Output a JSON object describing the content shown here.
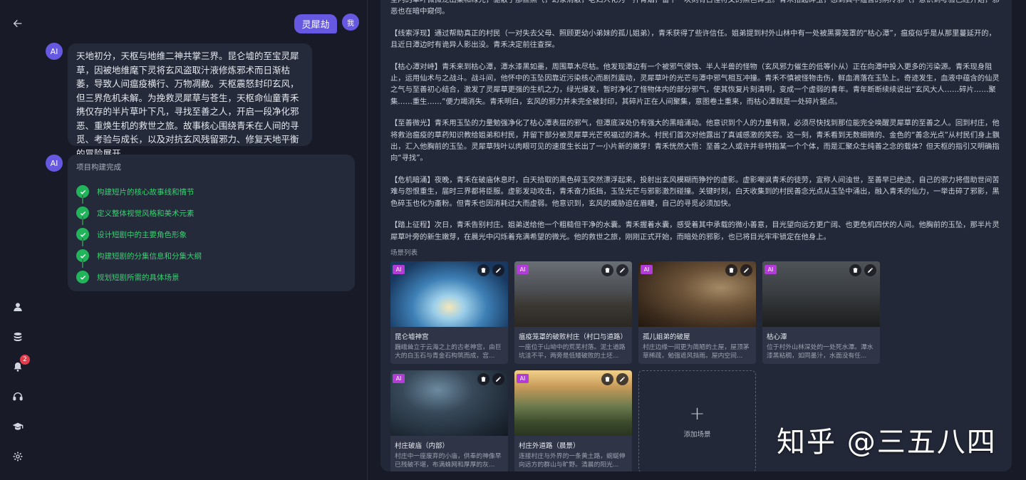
{
  "sidebar": {
    "notification_count": "2"
  },
  "chat": {
    "user_message": "灵犀劫",
    "user_avatar_label": "我",
    "ai_avatar_label": "AI",
    "ai_message": "天地初分，天枢与地维二神共掌三界。昆仑墟的至宝灵犀草，因被地维麾下灵将玄风盗取汁液修炼邪术而日渐枯萎，导致人间瘟疫横行、万物凋敝。天枢震怒封印玄风，但三界危机未解。为挽救灵犀草与苍生，天枢命仙童青禾携仅存的半片草叶下凡，寻找至善之人，开启一段净化邪恶、重焕生机的救世之旅。故事核心围绕青禾在人间的寻觅、考验与成长，以及对抗玄风残留邪力、修复天地平衡的冒险展开。",
    "steps_title": "项目构建完成",
    "steps": [
      "构建短片的核心故事线和情节",
      "定义整体视觉风格和美术元素",
      "设计短剧中的主要角色形象",
      "构建短剧的分集信息和分集大纲",
      "规划短剧所需的具体场景"
    ]
  },
  "story": {
    "paragraphs": [
      "坚内的草叶微微泛出柔和绿光，驱散了那丝黑气，幻象消散，老妇人化为一抔青烟，留下一块刻有古怪符文的黑色碎玉。青禾拾起碎玉，感到其中蕴含的阴冷邪气，意识到考验已经开始，邪恶也在暗中窥伺。",
      "【线索浮现】通过帮助真正的村民（一对失去父母、照顾更幼小弟妹的孤儿姐弟），青禾获得了些许信任。姐弟提到村外山林中有一处被黑雾笼罩的“枯心潭”，瘟疫似乎是从那里蔓延开的，且近日潭边时有诡异人影出没。青禾决定前往查探。",
      "【枯心潭对峙】青禾来到枯心潭，潭水漆黑如墨，周围草木尽枯。他发现潭边有一个被邪气侵蚀、半人半兽的怪物（玄风邪力催生的低等仆从）正在向潭中投入更多的污染源。青禾现身阻止，运用仙术与之战斗。战斗间，他怀中的玉坠因靠近污染核心而剧烈震动，灵犀草叶的光芒与潭中邪气相互冲撞。青禾不慎被怪物击伤，鲜血滴落在玉坠上。奇迹发生，血液中蕴含的仙灵之气与至善初心结合，激发了灵犀草更强的生机之力，绿光爆发，暂时净化了怪物体内的部分邪气，使其恢复片刻清明，变成一个虚弱的青年。青年断断续续说出“玄风大人……碎片……聚集……重生……”便力竭消失。青禾明白，玄风的邪力并未完全被封印，其碎片正在人间聚集，意图卷土重来，而枯心潭就是一处碎片据点。",
      "【至善微光】青禾用玉坠的力量勉强净化了枯心潭表层的邪气，但潭底深处仍有强大的黑暗涌动。他意识到个人的力量有限，必须尽快找到那位能完全唤醒灵犀草的至善之人。回到村庄，他将救治瘟疫的草药知识教给姐弟和村民，并留下部分被灵犀草光芒祝福过的清水。村民们首次对他露出了真诚感激的笑容。这一刻，青禾看到无数细微的、金色的“善念光点”从村民们身上飘出，汇入他胸前的玉坠。灵犀草残叶以肉眼可见的速度生长出了一小片新的嫩芽！青禾恍然大悟：至善之人或许并非特指某一个个体，而是汇聚众生纯善之念的载体？但天枢的指引又明确指向“寻找”。",
      "【危机暗涌】夜晚，青禾在破庙休息时，白天拾取的黑色碎玉突然漂浮起来，投射出玄风模糊而狰狞的虚影。虚影嘲讽青禾的徒劳，宣称人间浊世，至善早已绝迹，自己的邪力将借助世间苦难与怨恨重生，届时三界都将臣服。虚影发动攻击，青禾奋力抵挡，玉坠光芒与邪影激烈碰撞。关键时刻，白天收集到的村民善念光点从玉坠中涌出，融入青禾的仙力，一举击碎了邪影，黑色碎玉也化为齑粉。但青禾也因消耗过大而虚弱。他意识到，玄风的威胁迫在眉睫，自己的寻觅必须加快。",
      "【踏上征程】次日，青禾告别村庄。姐弟送给他一个粗糙但干净的水囊。青禾握着水囊，感受着其中承载的微小善意，目光望向远方更广阔、也更危机四伏的人间。他胸前的玉坠，那半片灵犀草叶旁的新生嫩芽，在晨光中闪烁着充满希望的微光。他的救世之旅，刚刚正式开始，而暗处的邪影，也已将目光牢牢锁定在他身上。"
    ]
  },
  "scenes": {
    "label": "场景列表",
    "ai_tag": "AI",
    "items": [
      {
        "name": "昆仑墟神宫",
        "desc": "巍峨耸立于云海之上的古老神宫，由巨大的白玉石与青金石构筑而成，宫..."
      },
      {
        "name": "瘟疫笼罩的破败村庄（村口与道路）",
        "desc": "一座位于山坳中的荒芜村落。泥土道路坑洼不平，两旁是低矮破败的土坯..."
      },
      {
        "name": "孤儿姐弟的破屋",
        "desc": "村庄边缘一间更为简陋的土屋，屋顶茅草稀疏，勉强遮风挡雨。屋内空间..."
      },
      {
        "name": "枯心潭",
        "desc": "位于村外山林深处的一处死水潭。潭水漆黑粘稠，如同墨汁，水面没有任..."
      },
      {
        "name": "村庄破庙（内部）",
        "desc": "村庄中一座废弃的小庙，供奉的神像早已残破不堪，布满蛛网和厚厚的灰..."
      },
      {
        "name": "村庄外道路（晨景）",
        "desc": "连接村庄与外界的一条黄土路，蜿蜒伸向远方的群山与旷野。清晨的阳光..."
      }
    ],
    "add_label": "添加场景"
  },
  "watermark": "知乎 @三五八四",
  "colors": {
    "accent": "#6658e0",
    "success": "#22b45a",
    "ai_tag": "#b33cd8",
    "panel": "#232838",
    "background": "#181b27"
  }
}
